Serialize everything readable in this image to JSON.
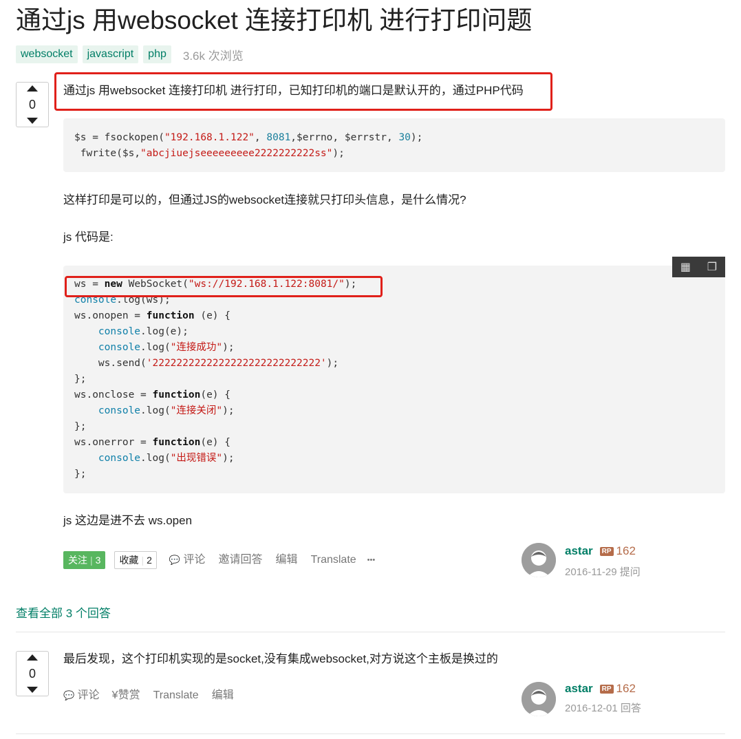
{
  "question": {
    "title": "通过js 用websocket 连接打印机 进行打印问题",
    "tags": [
      "websocket",
      "javascript",
      "php"
    ],
    "views": "3.6k 次浏览",
    "vote_count": "0",
    "intro": "通过js 用websocket 连接打印机 进行打印，已知打印机的端口是默认开的，通过PHP代码",
    "php_code_lines": [
      "$s = fsockopen(\"192.168.1.122\", 8081,$errno, $errstr, 30);",
      " fwrite($s,\"abcjiuejseeeeeeeee2222222222ss\");"
    ],
    "para1": "这样打印是可以的，但通过JS的websocket连接就只打印头信息，是什么情况?",
    "para2": "js 代码是:",
    "js_code_lines": [
      "ws = new WebSocket(\"ws://192.168.1.122:8081/\");",
      "console.log(ws);",
      "ws.onopen = function (e) {",
      "    console.log(e);",
      "    console.log(\"连接成功\");",
      "    ws.send('2222222222222222222222222222');",
      "};",
      "ws.onclose = function(e) {",
      "    console.log(\"连接关闭\");",
      "};",
      "ws.onerror = function(e) {",
      "    console.log(\"出现错误\");",
      "};"
    ],
    "para3": "js 这边是进不去 ws.open",
    "actions": {
      "follow_label": "关注",
      "follow_count": "3",
      "fav_label": "收藏",
      "fav_count": "2",
      "comment": "评论",
      "invite": "邀请回答",
      "edit": "编辑",
      "translate": "Translate",
      "more": "•••"
    },
    "author": {
      "name": "astar",
      "rp_badge": "RP",
      "rep": "162",
      "date": "2016-11-29 提问"
    }
  },
  "view_all": "查看全部 3 个回答",
  "answer": {
    "vote_count": "0",
    "text": "最后发现，这个打印机实现的是socket,没有集成websocket,对方说这个主板是换过的",
    "actions": {
      "comment": "评论",
      "reward": "赞赏",
      "translate": "Translate",
      "edit": "编辑"
    },
    "author": {
      "name": "astar",
      "rp_badge": "RP",
      "rep": "162",
      "date": "2016-12-01 回答"
    }
  },
  "colors": {
    "accent": "#017e66",
    "highlight_box": "#e0201a",
    "follow_button": "#58b65f",
    "rep": "#b56c4a"
  }
}
